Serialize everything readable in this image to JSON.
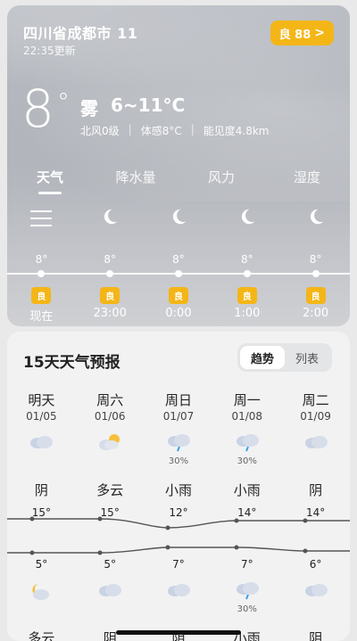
{
  "header": {
    "location": "四川省成都市 11",
    "updated": "22:35更新",
    "aqi_badge": "良 88",
    "aqi_chevron": ">"
  },
  "current": {
    "temp": "8",
    "degree": "°",
    "condition": "雾",
    "range": "6~11°C",
    "wind": "北风0级",
    "feels_like": "体感8°C",
    "visibility": "能见度4.8km"
  },
  "tabs": [
    {
      "label": "天气",
      "active": true
    },
    {
      "label": "降水量",
      "active": false
    },
    {
      "label": "风力",
      "active": false
    },
    {
      "label": "湿度",
      "active": false
    }
  ],
  "hourly": [
    {
      "icon": "menu-icon",
      "temp": "8°",
      "aqi": "良",
      "time": "现在"
    },
    {
      "icon": "moon-icon",
      "temp": "8°",
      "aqi": "良",
      "time": "23:00"
    },
    {
      "icon": "moon-icon",
      "temp": "8°",
      "aqi": "良",
      "time": "0:00"
    },
    {
      "icon": "moon-icon",
      "temp": "8°",
      "aqi": "良",
      "time": "1:00"
    },
    {
      "icon": "moon-icon",
      "temp": "8°",
      "aqi": "良",
      "time": "2:00"
    }
  ],
  "forecast": {
    "title": "15天天气预报",
    "view_trend": "趋势",
    "view_list": "列表",
    "days": [
      {
        "name": "明天",
        "date": "01/05",
        "day_icon": "cloud-icon",
        "day_prob": "",
        "day_cond": "阴",
        "high": "15°",
        "low": "5°",
        "night_icon": "moon-cloud-icon",
        "night_prob": "",
        "night_cond": "多云"
      },
      {
        "name": "周六",
        "date": "01/06",
        "day_icon": "sun-cloud-icon",
        "day_prob": "",
        "day_cond": "多云",
        "high": "15°",
        "low": "5°",
        "night_icon": "cloud-icon",
        "night_prob": "",
        "night_cond": "阴"
      },
      {
        "name": "周日",
        "date": "01/07",
        "day_icon": "rain-icon",
        "day_prob": "30%",
        "day_cond": "小雨",
        "high": "12°",
        "low": "7°",
        "night_icon": "cloud-icon",
        "night_prob": "",
        "night_cond": "阴"
      },
      {
        "name": "周一",
        "date": "01/08",
        "day_icon": "rain-icon",
        "day_prob": "30%",
        "day_cond": "小雨",
        "high": "14°",
        "low": "7°",
        "night_icon": "rain-icon",
        "night_prob": "30%",
        "night_cond": "小雨"
      },
      {
        "name": "周二",
        "date": "01/09",
        "day_icon": "cloud-icon",
        "day_prob": "",
        "day_cond": "阴",
        "high": "14°",
        "low": "6°",
        "night_icon": "cloud-icon",
        "night_prob": "",
        "night_cond": "阴"
      }
    ]
  },
  "colors": {
    "aqi": "#f4b617",
    "hero_bg": "#b4b7bd",
    "panel_bg": "#f2f2f3"
  }
}
